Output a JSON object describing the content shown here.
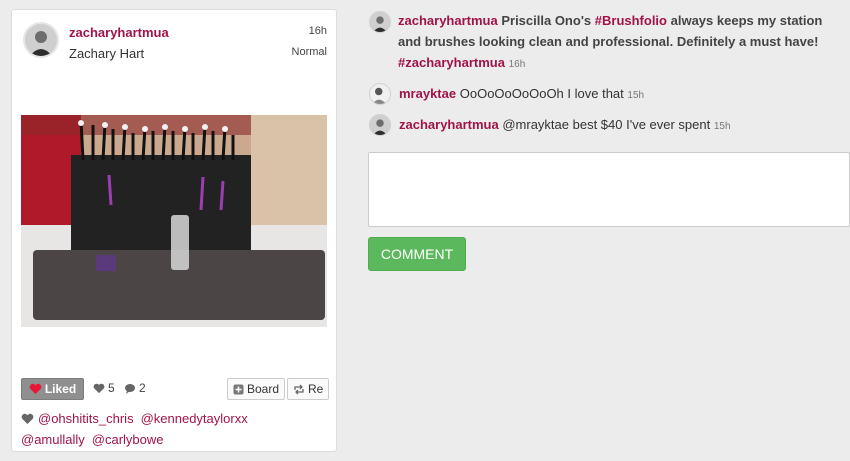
{
  "post": {
    "username": "zacharyhartmua",
    "full_name": "Zachary Hart",
    "time": "16h",
    "level": "Normal",
    "liked_label": "Liked",
    "like_count": "5",
    "comment_count": "2",
    "board_label": "Board",
    "repost_label": "Re",
    "likers": [
      "@ohshitits_chris",
      "@kennedytaylorxx",
      "@amullally",
      "@carlybowe"
    ]
  },
  "caption": {
    "username": "zacharyhartmua",
    "text_before": "Priscilla Ono's",
    "hashtag1": "#Brushfolio",
    "text_after": "always keeps my station and brushes looking clean and professional. Definitely a must have!",
    "hashtag2": "#zacharyhartmua",
    "time": "16h"
  },
  "comments": [
    {
      "username": "mrayktae",
      "text": "OoOoOoOoOoOh I love that",
      "time": "15h"
    },
    {
      "username": "zacharyhartmua",
      "text": "@mrayktae best $40 I've ever spent",
      "time": "15h"
    }
  ],
  "comment_form": {
    "button_label": "COMMENT"
  },
  "colors": {
    "accent": "#a0134a",
    "button_green": "#5cb85c",
    "background": "#ececec"
  }
}
